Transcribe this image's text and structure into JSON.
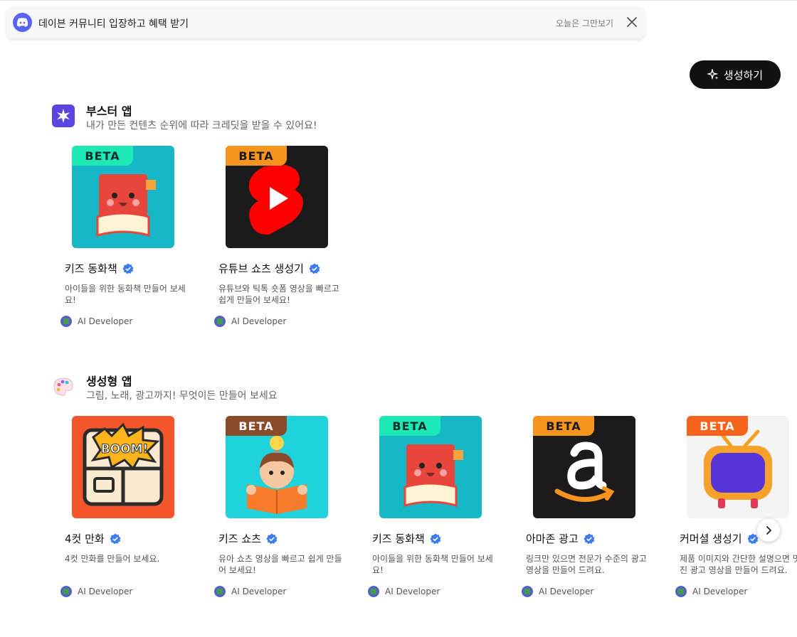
{
  "banner": {
    "text": "데이븐 커뮤니티 입장하고 혜택 받기",
    "dismiss_label": "오늘은 그만보기",
    "logo_icon": "discord-icon",
    "close_icon": "close-icon"
  },
  "header": {
    "create_button_label": "생성하기",
    "create_icon": "sparkle-icon"
  },
  "sections": [
    {
      "title": "부스터 앱",
      "subtitle": "내가 만든 컨텐츠 순위에 따라 크레딧을 받을 수 있어요!",
      "icon": "star-badge-icon",
      "cards": [
        {
          "title": "키즈 동화책",
          "description": "아이들을 위한 동화책 만들어 보세요!",
          "developer": "AI Developer",
          "badge": "BETA",
          "verified": true,
          "thumb_icon": "storybook-icon"
        },
        {
          "title": "유튜브 쇼츠 생성기",
          "description": "유튜브와 틱톡 숏폼 영상을 빠르고 쉽게 만들어 보세요!",
          "developer": "AI Developer",
          "badge": "BETA",
          "verified": true,
          "thumb_icon": "youtube-shorts-icon"
        }
      ]
    },
    {
      "title": "생성형 앱",
      "subtitle": "그림, 노래, 광고까지! 무엇이든 만들어 보세요",
      "icon": "palette-icon",
      "cards": [
        {
          "title": "4컷 만화",
          "description": "4컷 만화를 만들어 보세요.",
          "developer": "AI Developer",
          "badge": "",
          "verified": true,
          "thumb_icon": "comic-boom-icon"
        },
        {
          "title": "키즈 쇼츠",
          "description": "유아 쇼츠 영상을 빠르고 쉽게 만들어 보세요!",
          "developer": "AI Developer",
          "badge": "BETA",
          "verified": true,
          "thumb_icon": "kid-reading-icon"
        },
        {
          "title": "키즈 동화책",
          "description": "아이들을 위한 동화책 만들어 보세요!",
          "developer": "AI Developer",
          "badge": "BETA",
          "verified": true,
          "thumb_icon": "storybook-icon"
        },
        {
          "title": "아마존 광고",
          "description": "링크만 있으면 전문가 수준의 광고 영상을 만들어 드려요.",
          "developer": "AI Developer",
          "badge": "BETA",
          "verified": true,
          "thumb_icon": "amazon-logo-icon"
        },
        {
          "title": "커머셜 생성기",
          "description": "제품 이미지와 간단한 설명으면 멋진 광고 영상을 만들어 드려요.",
          "developer": "AI Developer",
          "badge": "BETA",
          "verified": true,
          "thumb_icon": "retro-tv-icon"
        }
      ]
    }
  ],
  "carousel": {
    "next_icon": "chevron-right-icon"
  },
  "colors": {
    "accent": "#111111",
    "verified": "#3d7cf0",
    "discord": "#5865f2",
    "beta_teal": "#1de9b6",
    "beta_orange": "#f7941d",
    "beta_brown": "#8a4b2a"
  }
}
